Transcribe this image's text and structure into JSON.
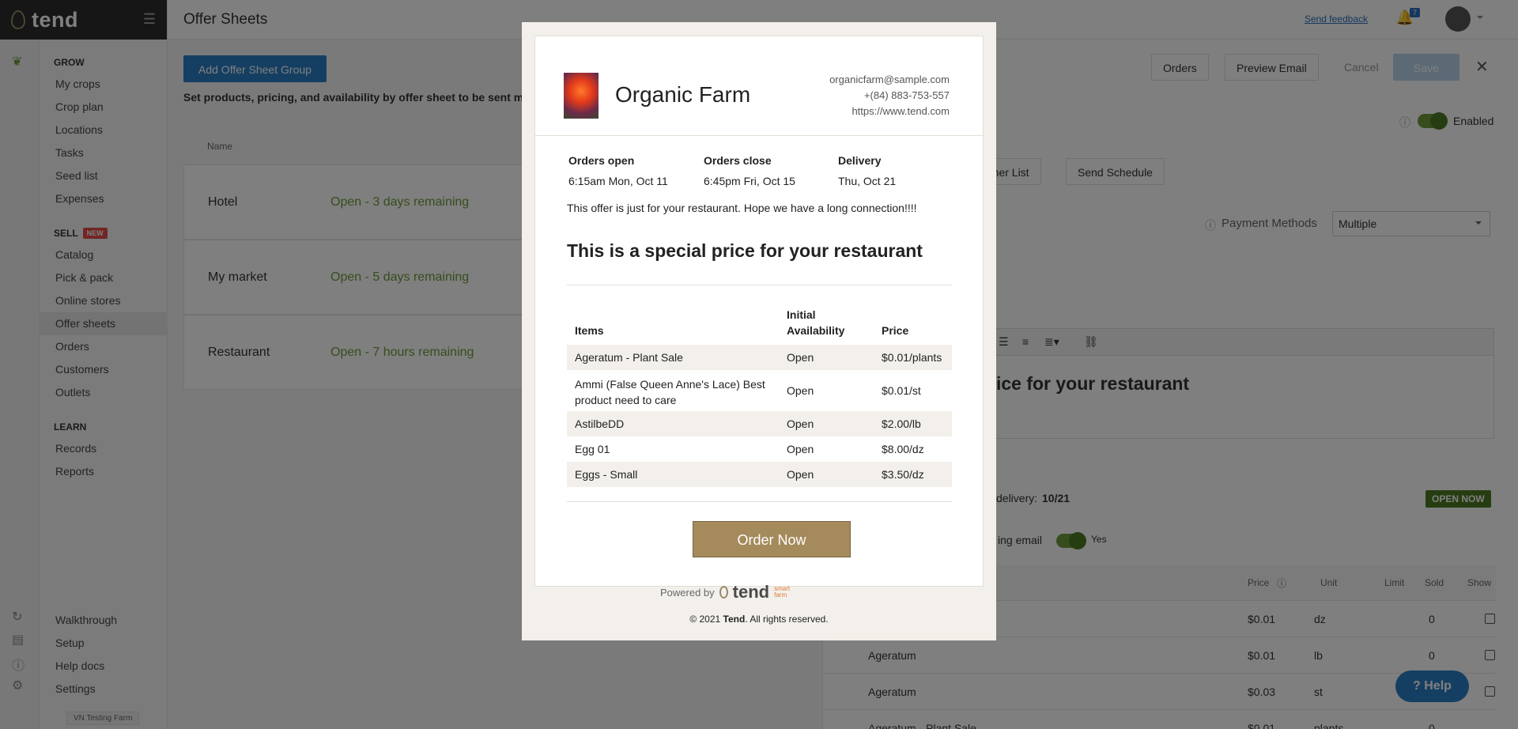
{
  "app": {
    "brand": "tend",
    "page_title": "Offer Sheets"
  },
  "header": {
    "feedback_label": "Send feedback",
    "notification_count": "7"
  },
  "sidebar": {
    "sections": [
      {
        "title": "GROW",
        "items": [
          "My crops",
          "Crop plan",
          "Locations",
          "Tasks",
          "Seed list",
          "Expenses"
        ]
      },
      {
        "title": "SELL",
        "badge": "NEW",
        "items": [
          "Catalog",
          "Pick & pack",
          "Online stores",
          "Offer sheets",
          "Orders",
          "Customers",
          "Outlets"
        ]
      },
      {
        "title": "LEARN",
        "items": [
          "Records",
          "Reports"
        ]
      }
    ],
    "active_item": "Offer sheets",
    "bottom_items": [
      "Walkthrough",
      "Setup",
      "Help docs",
      "Settings"
    ],
    "farm_tag": "VN Testing Farm"
  },
  "main": {
    "add_group_label": "Add Offer Sheet Group",
    "description": "Set products, pricing, and availability by offer sheet to be sent manual",
    "list_header": "Name",
    "rows": [
      {
        "name": "Hotel",
        "status": "Open - 3 days remaining"
      },
      {
        "name": "My market",
        "status": "Open - 5 days remaining"
      },
      {
        "name": "Restaurant",
        "status": "Open - 7 hours remaining"
      }
    ]
  },
  "panel": {
    "orders_label": "Orders",
    "preview_label": "Preview Email",
    "cancel_label": "Cancel",
    "save_label": "Save",
    "enabled_label": "Enabled",
    "customer_list_label": "omer List",
    "send_schedule_label": "Send Schedule",
    "payment_methods_label": "Payment Methods",
    "payment_methods_value": "Multiple",
    "editor_text": "rice for your restaurant",
    "delivery_label": "delivery:",
    "delivery_value": "10/21",
    "open_now_label": "OPEN NOW",
    "email_label": "ing email",
    "email_toggle_label": "Yes",
    "table_headers": [
      "Price",
      "Unit",
      "Limit",
      "Sold",
      "Show"
    ],
    "table_rows": [
      {
        "name": "",
        "price": "$0.01",
        "unit": "dz",
        "sold": "0"
      },
      {
        "name": "Ageratum",
        "price": "$0.01",
        "unit": "lb",
        "sold": "0"
      },
      {
        "name": "Ageratum",
        "price": "$0.03",
        "unit": "st",
        "sold": "0"
      },
      {
        "name": "Ageratum - Plant Sale",
        "price": "$0.01",
        "unit": "plants",
        "sold": "0"
      }
    ],
    "help_label": "Help"
  },
  "modal": {
    "farm_name": "Organic Farm",
    "email": "organicfarm@sample.com",
    "phone": "+(84) 883-753-557",
    "website": "https://www.tend.com",
    "orders_open_label": "Orders open",
    "orders_open_value": "6:15am Mon, Oct 11",
    "orders_close_label": "Orders close",
    "orders_close_value": "6:45pm Fri, Oct 15",
    "delivery_label": "Delivery",
    "delivery_value": "Thu, Oct 21",
    "message": "This offer is just for your restaurant. Hope we have a long connection!!!!",
    "headline": "This is a special price for your restaurant",
    "items_header": "Items",
    "availability_header_line1": "Initial",
    "availability_header_line2": "Availability",
    "price_header": "Price",
    "items": [
      {
        "name": "Ageratum - Plant Sale",
        "availability": "Open",
        "price": "$0.01/plants"
      },
      {
        "name": "Ammi (False Queen Anne's Lace) Best product need to care",
        "availability": "Open",
        "price": "$0.01/st"
      },
      {
        "name": "AstilbeDD",
        "availability": "Open",
        "price": "$2.00/lb"
      },
      {
        "name": "Egg 01",
        "availability": "Open",
        "price": "$8.00/dz"
      },
      {
        "name": "Eggs - Small",
        "availability": "Open",
        "price": "$3.50/dz"
      }
    ],
    "order_button": "Order Now",
    "powered_by": "Powered by",
    "powered_brand": "tend",
    "powered_sub": "smart farm",
    "copyright_prefix": "© 2021",
    "copyright_brand": "Tend",
    "copyright_suffix": ". All rights reserved."
  }
}
